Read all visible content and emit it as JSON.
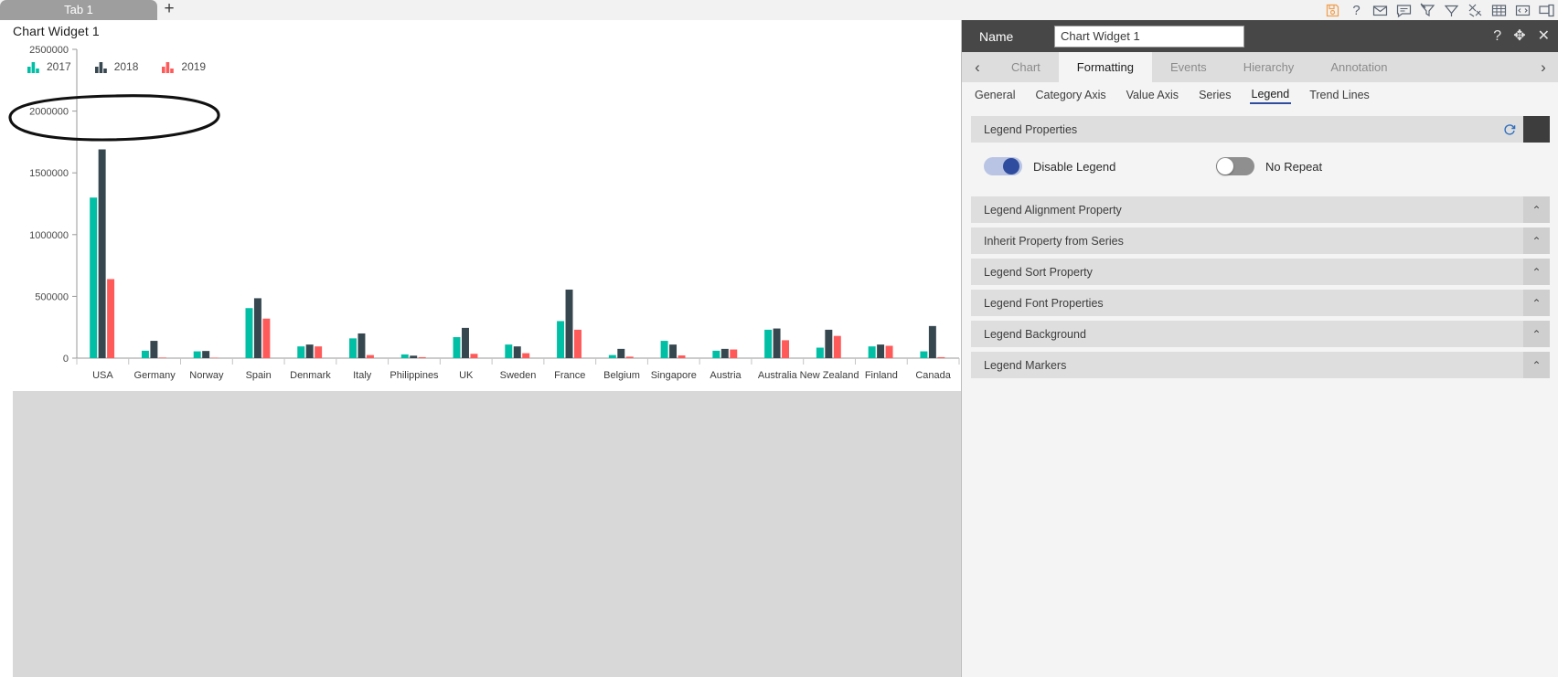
{
  "topbar": {
    "tabs": [
      {
        "label": "Tab 1"
      }
    ],
    "add_tab_label": "+",
    "icons": [
      {
        "name": "save-icon",
        "title": "Save"
      },
      {
        "name": "help-icon",
        "title": "Help"
      },
      {
        "name": "mail-icon",
        "title": "Mail"
      },
      {
        "name": "comment-icon",
        "title": "Comment"
      },
      {
        "name": "clear-filter-icon",
        "title": "Clear Filter"
      },
      {
        "name": "filter-icon",
        "title": "Filter"
      },
      {
        "name": "tools-icon",
        "title": "Tools"
      },
      {
        "name": "table-icon",
        "title": "Table"
      },
      {
        "name": "code-icon",
        "title": "Code"
      },
      {
        "name": "devices-icon",
        "title": "Devices"
      }
    ]
  },
  "widget": {
    "title": "Chart Widget 1"
  },
  "chart_data": {
    "type": "bar",
    "title": "",
    "xlabel": "",
    "ylabel": "",
    "ylim": [
      0,
      2500000
    ],
    "ytick_labels": [
      "0",
      "500000",
      "1000000",
      "1500000",
      "2000000",
      "2500000"
    ],
    "yticks": [
      0,
      500000,
      1000000,
      1500000,
      2000000,
      2500000
    ],
    "grid": false,
    "legend_position": "top-left",
    "categories": [
      "USA",
      "Germany",
      "Norway",
      "Spain",
      "Denmark",
      "Italy",
      "Philippines",
      "UK",
      "Sweden",
      "France",
      "Belgium",
      "Singapore",
      "Austria",
      "Australia",
      "New Zealand",
      "Finland",
      "Canada"
    ],
    "series": [
      {
        "name": "2017",
        "color": "#00bfa5",
        "values": [
          1300000,
          60000,
          55000,
          405000,
          95000,
          160000,
          30000,
          170000,
          110000,
          300000,
          25000,
          140000,
          60000,
          230000,
          85000,
          95000,
          55000
        ]
      },
      {
        "name": "2018",
        "color": "#37474f",
        "values": [
          1690000,
          140000,
          58000,
          485000,
          110000,
          200000,
          20000,
          245000,
          95000,
          555000,
          75000,
          110000,
          75000,
          240000,
          230000,
          110000,
          260000
        ]
      },
      {
        "name": "2019",
        "color": "#ff5a5a",
        "values": [
          640000,
          5000,
          4000,
          320000,
          95000,
          25000,
          8000,
          35000,
          40000,
          230000,
          12000,
          22000,
          70000,
          145000,
          180000,
          100000,
          8000
        ]
      }
    ]
  },
  "annotation": {
    "shape": "hand-drawn-ellipse",
    "target": "chart-legend"
  },
  "panel": {
    "header": {
      "name_label": "Name",
      "name_value": "Chart Widget 1",
      "name_placeholder": "",
      "icons": [
        {
          "name": "help-icon",
          "glyph": "?"
        },
        {
          "name": "move-icon",
          "glyph": "✥"
        },
        {
          "name": "close-icon",
          "glyph": "✕"
        }
      ]
    },
    "tabs": [
      {
        "label": "Chart",
        "active": false
      },
      {
        "label": "Formatting",
        "active": true
      },
      {
        "label": "Events",
        "active": false
      },
      {
        "label": "Hierarchy",
        "active": false
      },
      {
        "label": "Annotation",
        "active": false
      }
    ],
    "tab_prev_glyph": "‹",
    "tab_next_glyph": "›",
    "subtabs": [
      {
        "label": "General",
        "active": false
      },
      {
        "label": "Category Axis",
        "active": false
      },
      {
        "label": "Value Axis",
        "active": false
      },
      {
        "label": "Series",
        "active": false
      },
      {
        "label": "Legend",
        "active": true
      },
      {
        "label": "Trend Lines",
        "active": false
      }
    ],
    "sections": [
      {
        "title": "Legend Properties",
        "expanded": true,
        "swatch_color": "#3d3d3d",
        "toggles": [
          {
            "label": "Disable Legend",
            "state": "on"
          },
          {
            "label": "No Repeat",
            "state": "off"
          }
        ]
      },
      {
        "title": "Legend Alignment Property",
        "expanded": false
      },
      {
        "title": "Inherit Property from Series",
        "expanded": false
      },
      {
        "title": "Legend Sort Property",
        "expanded": false
      },
      {
        "title": "Legend Font Properties",
        "expanded": false
      },
      {
        "title": "Legend Background",
        "expanded": false
      },
      {
        "title": "Legend Markers",
        "expanded": false
      }
    ],
    "collapse_glyph": "⌃"
  }
}
